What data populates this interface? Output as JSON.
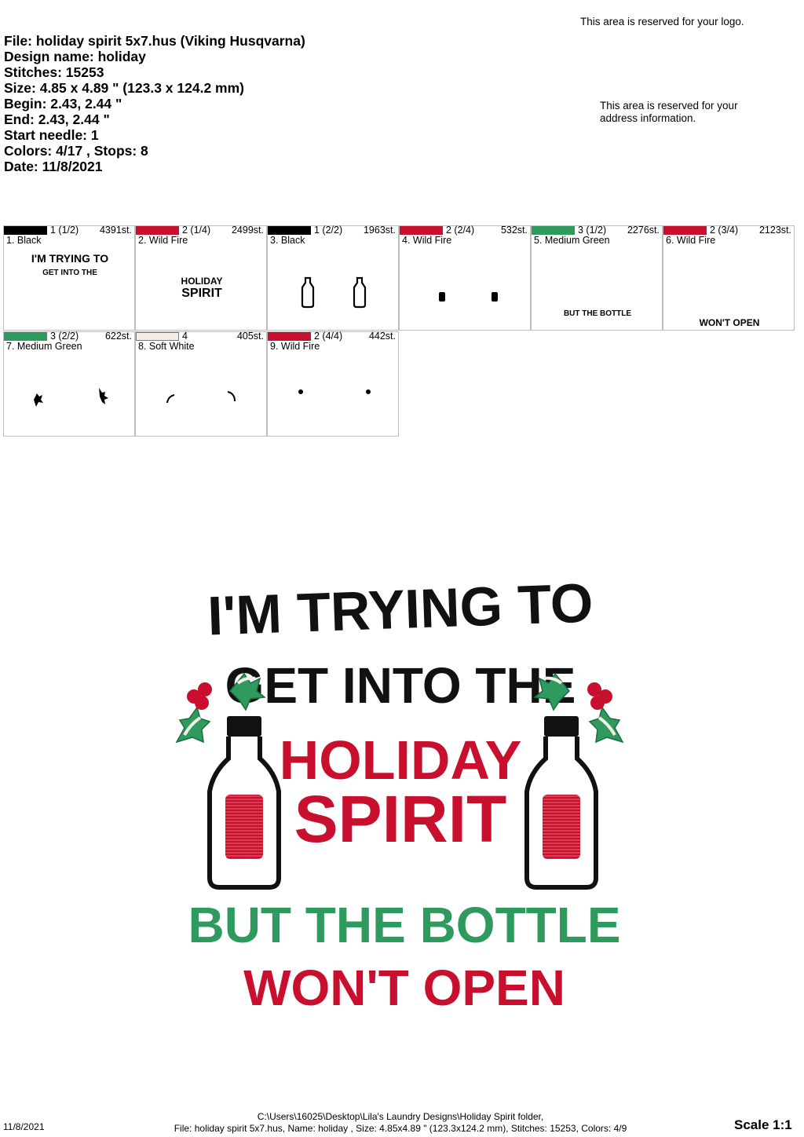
{
  "info": {
    "file": "File: holiday spirit 5x7.hus  (Viking Husqvarna)",
    "design_name": "Design name: holiday",
    "stitches": "Stitches: 15253",
    "size": "Size: 4.85 x 4.89 \" (123.3 x 124.2 mm)",
    "begin": "Begin: 2.43, 2.44 \"",
    "end": "End: 2.43, 2.44 \"",
    "start_needle": "Start needle: 1",
    "colors": "Colors: 4/17 , Stops: 8",
    "date": "Date: 11/8/2021"
  },
  "reserved": {
    "logo": "This area is reserved for your logo.",
    "address": "This area is reserved for your address information."
  },
  "colors": {
    "black": "#000000",
    "wild_fire": "#c8102e",
    "medium_green": "#2e9a5e",
    "soft_white": "#f3efe6"
  },
  "stops": [
    {
      "needle": "1 (1/2)",
      "stitches": "4391st.",
      "name": "1. Black",
      "color": "#000000"
    },
    {
      "needle": "2 (1/4)",
      "stitches": "2499st.",
      "name": "2. Wild Fire",
      "color": "#c8102e"
    },
    {
      "needle": "1 (2/2)",
      "stitches": "1963st.",
      "name": "3. Black",
      "color": "#000000"
    },
    {
      "needle": "2 (2/4)",
      "stitches": "532st.",
      "name": "4. Wild Fire",
      "color": "#c8102e"
    },
    {
      "needle": "3 (1/2)",
      "stitches": "2276st.",
      "name": "5. Medium Green",
      "color": "#2e9a5e"
    },
    {
      "needle": "2 (3/4)",
      "stitches": "2123st.",
      "name": "6. Wild Fire",
      "color": "#c8102e"
    },
    {
      "needle": "3 (2/2)",
      "stitches": "622st.",
      "name": "7. Medium Green",
      "color": "#2e9a5e"
    },
    {
      "needle": "4",
      "stitches": "405st.",
      "name": "8. Soft White",
      "color": "#f3efe6"
    },
    {
      "needle": "2 (4/4)",
      "stitches": "442st.",
      "name": "9. Wild Fire",
      "color": "#c8102e"
    }
  ],
  "preview_text": {
    "stop1_line1": "I'M TRYING TO",
    "stop1_line2": "GET INTO THE",
    "stop2_line1": "HOLIDAY",
    "stop2_line2": "SPIRIT",
    "stop5": "BUT THE BOTTLE",
    "stop6": "WON'T OPEN"
  },
  "design": {
    "line1": "I'M TRYING TO",
    "line2": "GET INTO THE",
    "line3": "HOLIDAY",
    "line4": "SPIRIT",
    "line5": "BUT THE BOTTLE",
    "line6": "WON'T  OPEN"
  },
  "footer": {
    "date": "11/8/2021",
    "path": "C:\\Users\\16025\\Desktop\\Lila's Laundry Designs\\Holiday Spirit folder,",
    "summary": "File: holiday spirit 5x7.hus, Name: holiday , Size: 4.85x4.89 \" (123.3x124.2 mm), Stitches: 15253, Colors: 4/9",
    "scale": "Scale 1:1"
  }
}
